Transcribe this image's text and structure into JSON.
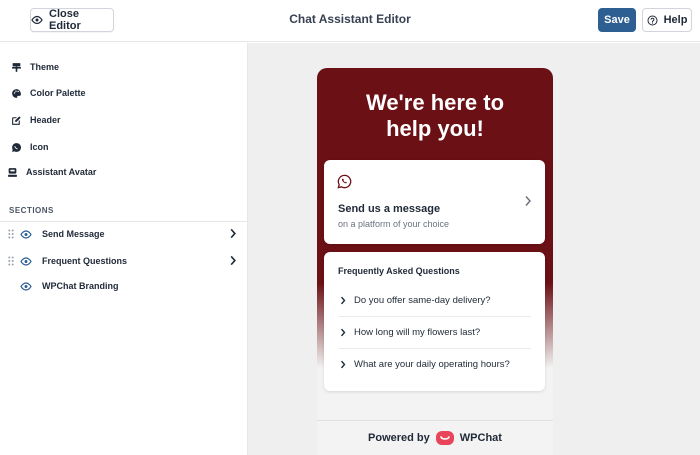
{
  "header": {
    "close_label": "Close Editor",
    "title": "Chat Assistant Editor",
    "save_label": "Save",
    "help_label": "Help"
  },
  "sidebar": {
    "items": [
      {
        "label": "Theme",
        "icon": "theme-icon"
      },
      {
        "label": "Color Palette",
        "icon": "palette-icon"
      },
      {
        "label": "Header",
        "icon": "edit-icon"
      },
      {
        "label": "Icon",
        "icon": "chat-bubble-icon"
      },
      {
        "label": "Assistant Avatar",
        "icon": "avatar-icon"
      }
    ],
    "sections_label": "SECTIONS",
    "sections": [
      {
        "label": "Send Message",
        "visible": true,
        "expandable": true
      },
      {
        "label": "Frequent Questions",
        "visible": true,
        "expandable": true
      },
      {
        "label": "WPChat Branding",
        "visible": true,
        "expandable": false
      }
    ]
  },
  "widget": {
    "hero": "We're here to help you!",
    "send": {
      "title": "Send us a message",
      "subtitle": "on a platform of your choice"
    },
    "faq": {
      "title": "Frequently Asked Questions",
      "items": [
        "Do you offer same-day delivery?",
        "How long will my flowers last?",
        "What are your daily operating hours?"
      ]
    },
    "footer": {
      "prefix": "Powered by",
      "brand": "WPChat"
    }
  },
  "colors": {
    "accent": "#6b1015",
    "save_button": "#2d5f93",
    "brand_logo": "#e8445a"
  }
}
